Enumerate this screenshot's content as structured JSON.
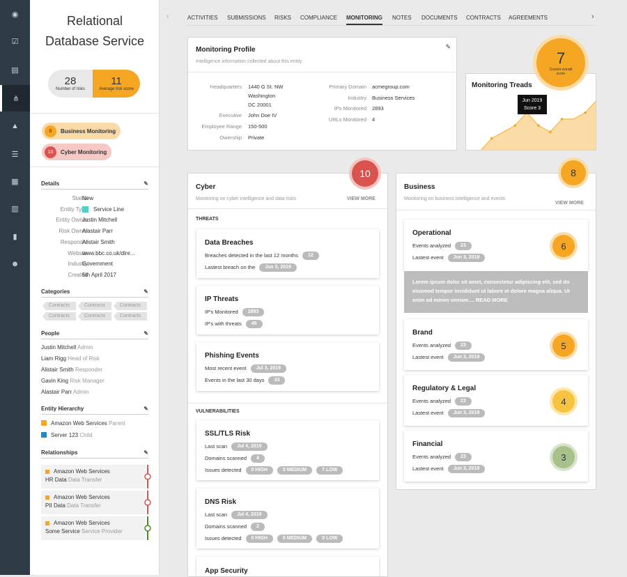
{
  "nav": {
    "icons": [
      "dashboard-icon",
      "check-icon",
      "document-icon",
      "hierarchy-icon",
      "warning-icon",
      "list-icon",
      "calendar-icon",
      "table-icon",
      "chart-icon",
      "users-icon"
    ]
  },
  "sidebar": {
    "title_line1": "Relational",
    "title_line2": "Database Service",
    "risks_count": "28",
    "risks_label": "Number of risks",
    "avg_score": "11",
    "avg_label": "Average risk score",
    "monitoring": [
      {
        "count": "8",
        "label": "Business Monitoring"
      },
      {
        "count": "10",
        "label": "Cyber Monitoring"
      }
    ],
    "details_title": "Details",
    "details": [
      {
        "k": "Status",
        "v": "New"
      },
      {
        "k": "Entity Type",
        "v": "Service Line"
      },
      {
        "k": "Entity Owner",
        "v": "Justin Mitchell"
      },
      {
        "k": "Risk Owner",
        "v": "Alastair Parr"
      },
      {
        "k": "Responder",
        "v": "Alistair Smith"
      },
      {
        "k": "Website",
        "v": "www.bbc.co.uk/dire..."
      },
      {
        "k": "Industry",
        "v": "Government"
      },
      {
        "k": "Created",
        "v": "5th April 2017"
      }
    ],
    "categories_title": "Categories",
    "categories": [
      "Contracts",
      "Contracts",
      "Contracts",
      "Contracts",
      "Contracts",
      "Contracts"
    ],
    "people_title": "People",
    "people": [
      {
        "n": "Justin Mitchell",
        "r": "Admin"
      },
      {
        "n": "Liam Rigg",
        "r": "Head of Risk"
      },
      {
        "n": "Alistair Smith",
        "r": "Responder"
      },
      {
        "n": "Gavin King",
        "r": "Risk Manager"
      },
      {
        "n": "Alastair Parr",
        "r": "Admin"
      }
    ],
    "hierarchy_title": "Entity Hierarchy",
    "hierarchy": [
      {
        "n": "Amazon Web Services",
        "r": "Parent"
      },
      {
        "n": "Server 123",
        "r": "Child"
      }
    ],
    "relationships_title": "Relationships",
    "relationships": [
      {
        "a": "Amazon Web Services",
        "b": "HR Data",
        "c": "Data Transfer"
      },
      {
        "a": "Amazon Web Services",
        "b": "PII Data",
        "c": "Data Transfer"
      },
      {
        "a": "Amazon Web Services",
        "b": "Some Service",
        "c": "Service Provider"
      }
    ],
    "colors": {
      "orange": "#f5a623",
      "red": "#d9534f",
      "green": "#4a8a2a",
      "teal": "#4fd1c5",
      "blue": "#1e8bc3"
    }
  },
  "tabs": [
    "ACTIVITIES",
    "SUBMISSIONS",
    "RISKS",
    "COMPLIANCE",
    "MONITORING",
    "NOTES",
    "DOCUMENTS",
    "CONTRACTS",
    "AGREEMENTS"
  ],
  "profile": {
    "title": "Monitoring Profile",
    "subtitle": "Intelligence information collected about this entity",
    "left": [
      {
        "k": "Headquarters",
        "v": "1440 G St. NW"
      },
      {
        "k": "",
        "v": "Washington"
      },
      {
        "k": "",
        "v": "DC 20001"
      },
      {
        "k": "Executive",
        "v": "John Doe IV"
      },
      {
        "k": "Employee Range",
        "v": "150-500"
      },
      {
        "k": "Owership",
        "v": "Private"
      }
    ],
    "right": [
      {
        "k": "Primary Domain",
        "v": "acmegroup.com"
      },
      {
        "k": "Industry",
        "v": "Business Services"
      },
      {
        "k": "IPs Monitored",
        "v": "2893"
      },
      {
        "k": "URLs Monitored",
        "v": "4"
      }
    ]
  },
  "treads": {
    "title": "Monitoring Treads",
    "score": "7",
    "score_label": "Current overall score",
    "tip_date": "Jun 2019",
    "tip_score": "Score 3"
  },
  "chart_data": {
    "type": "area",
    "title": "Monitoring Treads",
    "y": [
      0,
      2,
      3,
      4,
      6,
      4,
      3,
      5,
      5,
      6,
      8
    ],
    "ylim": [
      0,
      9
    ],
    "highlight": {
      "label": "Jun 2019",
      "value": 3
    }
  },
  "cyber": {
    "title": "Cyber",
    "subtitle": "Monitoring on cyber intelligence and data risks",
    "view_more": "VIEW MORE",
    "score": "10",
    "threats_title": "THREATS",
    "threats": [
      {
        "t": "Data Breaches",
        "rows": [
          {
            "l": "Breaches detected in the last 12 months",
            "b": "12"
          },
          {
            "l": "Lastest breach on the",
            "b": "Jun 3, 2019"
          }
        ]
      },
      {
        "t": "IP Threats",
        "rows": [
          {
            "l": "IP's Monitored",
            "b": "2893"
          },
          {
            "l": "IP's with threats",
            "b": "49"
          }
        ]
      },
      {
        "t": "Phishing Events",
        "rows": [
          {
            "l": "Most recent event",
            "b": "Jul 3, 2019"
          },
          {
            "l": "Events in the last 30 days",
            "b": "33"
          }
        ]
      }
    ],
    "vuln_title": "VULNERABILITIES",
    "vulns": [
      {
        "t": "SSL/TLS Risk",
        "scan": "Jul 4, 2019",
        "domains": "4",
        "issues": [
          "0 HIGH",
          "5 MEDIUM",
          "7 LOW"
        ]
      },
      {
        "t": "DNS Risk",
        "scan": "Jul 4, 2019",
        "domains": "2",
        "issues": [
          "0 HIGH",
          "0 MEDIUM",
          "0 LOW"
        ]
      }
    ],
    "labels": {
      "scan": "Last scan",
      "domains": "Domains scanned",
      "issues": "Issues detected"
    },
    "app_security": "App Security"
  },
  "business": {
    "title": "Business",
    "subtitle": "Monitoring on business intelligence and events",
    "view_more": "VIEW MORE",
    "score": "8",
    "labels": {
      "events": "Events analyzed",
      "last": "Lastest event"
    },
    "items": [
      {
        "t": "Operational",
        "events": "23",
        "last": "Jun 3, 2019",
        "score": "6"
      },
      {
        "t": "Brand",
        "events": "23",
        "last": "Jun 3, 2019",
        "score": "5"
      },
      {
        "t": "Regulatory & Legal",
        "events": "23",
        "last": "Jun 3, 2019",
        "score": "4"
      },
      {
        "t": "Financial",
        "events": "23",
        "last": "Jun 3, 2019",
        "score": "3"
      }
    ],
    "lorem": "Lorem ipsum dolor sit amet, consectetur adipiscing elit, sed do eiusmod tempor incididunt ut labore et dolore magna aliqua. Ut enim ad minim veniam....",
    "read_more": "READ MORE"
  }
}
